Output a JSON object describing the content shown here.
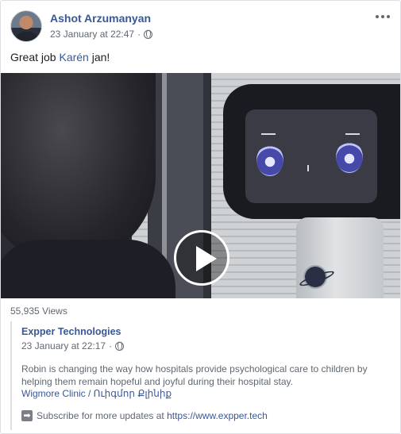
{
  "post": {
    "author": "Ashot Arzumanyan",
    "timestamp": "23 January at 22:47",
    "separator": "·",
    "text_prefix": "Great job ",
    "mention": "Karén",
    "text_suffix": " jan!"
  },
  "video": {
    "views": "55,935 Views"
  },
  "shared": {
    "page_name": "Expper Technologies",
    "timestamp": "23 January at 22:17",
    "separator": "·",
    "description": "Robin is changing the way how hospitals provide psychological care to children by helping them remain hopeful and joyful during their hospital stay.",
    "location_link": "Wigmore Clinic / Ուիգմոր Քլինիք",
    "subscribe_text": "Subscribe for more updates at ",
    "subscribe_link": "https://www.expper.tech",
    "arrow_glyph": "➡"
  },
  "icons": {
    "privacy": "globe-icon",
    "menu": "more-options-icon",
    "play": "play-icon"
  },
  "colors": {
    "link": "#385898",
    "meta": "#606770",
    "text": "#1c1e21",
    "border": "#dddfe2"
  }
}
